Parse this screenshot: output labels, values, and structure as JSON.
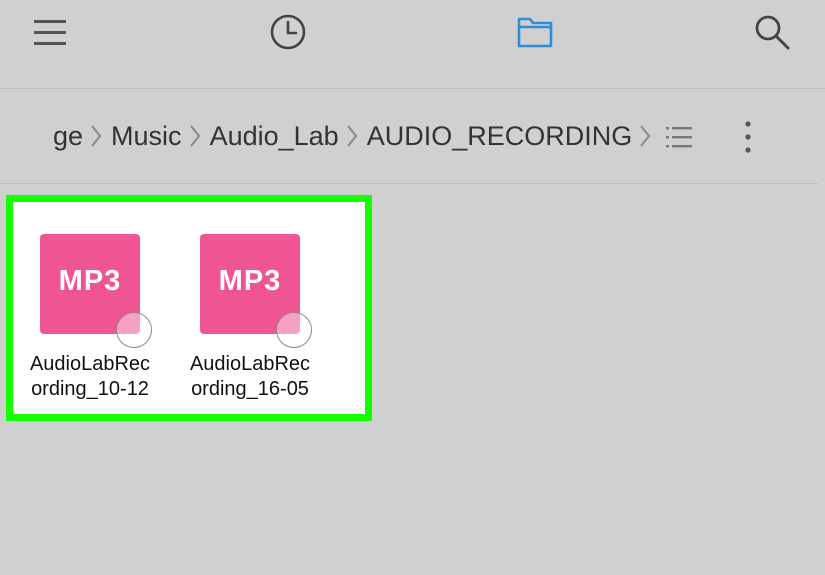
{
  "toolbar": {
    "icons": [
      "menu-icon",
      "history-icon",
      "folder-icon",
      "search-icon"
    ],
    "active_color": "#2c8ed6",
    "icon_color": "#555555"
  },
  "breadcrumb": {
    "segments": [
      "ge",
      "Music",
      "Audio_Lab",
      "AUDIO_RECORDING"
    ]
  },
  "files": [
    {
      "thumb_label": "MP3",
      "name_line1": "AudioLabRec",
      "name_line2": "ording_10-12"
    },
    {
      "thumb_label": "MP3",
      "name_line1": "AudioLabRec",
      "name_line2": "ording_16-05"
    }
  ],
  "colors": {
    "background": "#d0d0d0",
    "mp3_thumb": "#ef5592",
    "highlight_border": "#14ff00"
  }
}
